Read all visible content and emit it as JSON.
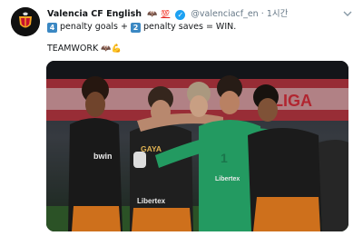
{
  "tweet": {
    "display_name": "Valencia CF English",
    "name_emoji_1": "🦇",
    "name_emoji_2": "💯",
    "verified_icon": "verified-badge-icon",
    "handle": "@valenciacf_en",
    "separator": "·",
    "timestamp": "1시간",
    "line1_num1": "4",
    "line1_text1": " penalty goals + ",
    "line1_num2": "2",
    "line1_text2": " penalty saves = WIN.",
    "line2_text": "TEAMWORK ",
    "line2_emoji_1": "🦇",
    "line2_emoji_2": "💪",
    "photo": {
      "description_icon": "team-celebration-photo",
      "jersey_text_1": "GAYA",
      "jersey_text_2": "Libertex",
      "jersey_text_3": "bwin",
      "banner_text": "LIGA"
    }
  },
  "colors": {
    "text": "#14171a",
    "muted": "#657786",
    "verified": "#1da1f2",
    "keycap": "#3b88c3",
    "kit_black": "#1c1c1c",
    "kit_orange": "#e07a1f",
    "keeper_green": "#27a86a"
  }
}
